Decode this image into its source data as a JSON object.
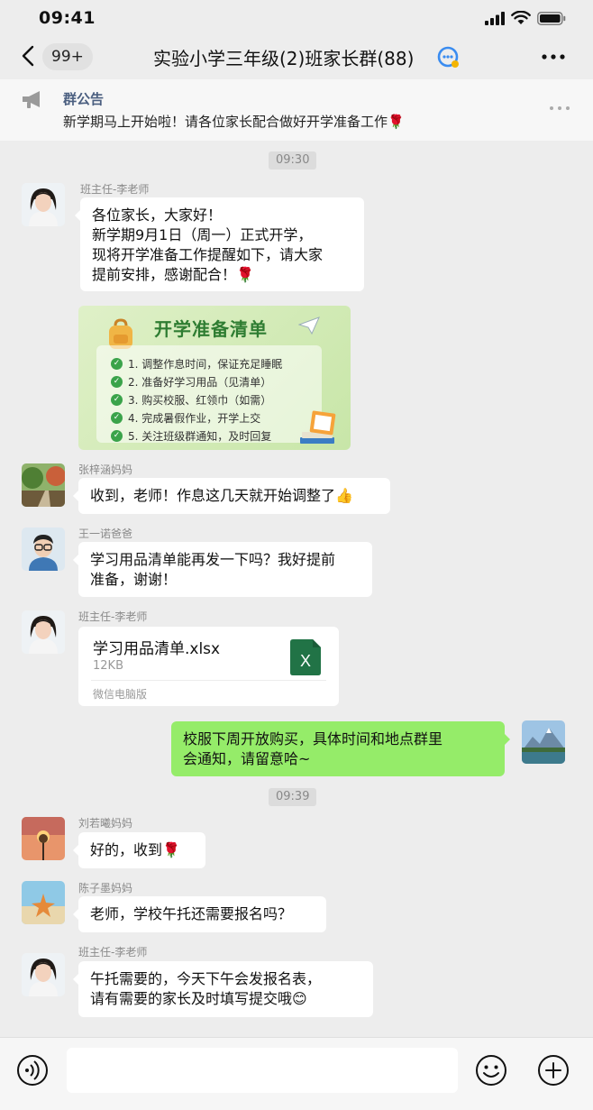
{
  "status_bar": {
    "time": "09:41"
  },
  "nav": {
    "unread_count": "99+",
    "title": "实验小学三年级(2)班家长群(88)"
  },
  "announcement": {
    "title": "群公告",
    "body": "新学期马上开始啦！请各位家长配合做好开学准备工作🌹"
  },
  "messages": [
    {
      "time_divider": "09:30"
    },
    {
      "sender": "班主任-李老师",
      "lines": [
        "各位家长，大家好！",
        "新学期9月1日（周一）正式开学，",
        "现将开学准备工作提醒如下，请大家",
        "提前安排，感谢配合！🌹"
      ]
    },
    {
      "card_title": "开学准备清单",
      "items": [
        "1. 调整作息时间，保证充足睡眠",
        "2. 准备好学习用品（见清单）",
        "3. 购买校服、红领巾（如需）",
        "4. 完成暑假作业，开学上交",
        "5. 关注班级群通知，及时回复"
      ]
    },
    {
      "sender": "张梓涵妈妈",
      "lines": [
        "收到，老师！作息这几天就开始调整了👍"
      ]
    },
    {
      "sender": "王一诺爸爸",
      "lines": [
        "学习用品清单能再发一下吗？我好提前",
        "准备，谢谢！"
      ]
    },
    {
      "sender": "班主任-李老师",
      "file": {
        "name": "学习用品清单.xlsx",
        "size": "12KB",
        "source": "微信电脑版"
      }
    },
    {
      "self": true,
      "lines": [
        "校服下周开放购买，具体时间和地点群里",
        "会通知，请留意哈~"
      ]
    },
    {
      "time_divider": "09:39"
    },
    {
      "sender": "刘若曦妈妈",
      "lines": [
        "好的，收到🌹"
      ]
    },
    {
      "sender": "陈子墨妈妈",
      "lines": [
        "老师，学校午托还需要报名吗？"
      ]
    },
    {
      "sender": "班主任-李老师",
      "lines": [
        "午托需要的，今天下午会发报名表，",
        "请有需要的家长及时填写提交哦😊"
      ]
    }
  ],
  "icons": {
    "back": "chevron-left-icon",
    "more": "more-dots-icon",
    "announcement": "megaphone-icon",
    "voice": "voice-icon",
    "emoji": "emoji-icon",
    "plus": "plus-icon",
    "file": "excel-file-icon"
  },
  "colors": {
    "background": "#ededed",
    "self_bubble": "#95ec69",
    "other_bubble": "#ffffff",
    "excel_green": "#217346"
  }
}
